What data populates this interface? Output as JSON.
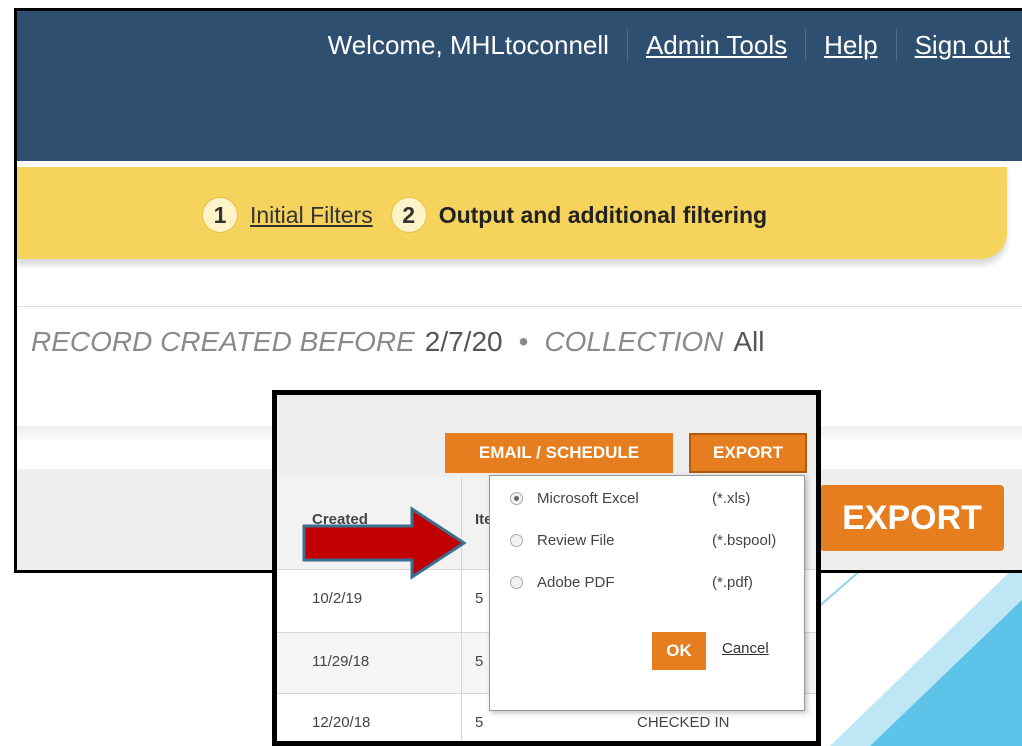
{
  "header": {
    "welcome": "Welcome, MHLtoconnell",
    "links": [
      "Admin Tools",
      "Help",
      "Sign out"
    ]
  },
  "steps": [
    {
      "num": "1",
      "label": "Initial Filters"
    },
    {
      "num": "2",
      "label": "Output and additional filtering"
    }
  ],
  "summary": {
    "created_label": "RECORD CREATED BEFORE",
    "created_value": "2/7/20",
    "sep": "•",
    "collection_label": "COLLECTION",
    "collection_value": "All"
  },
  "toolbar": {
    "export_big": "EXPORT",
    "email_schedule": "EMAIL / SCHEDULE",
    "export_small": "EXPORT"
  },
  "table": {
    "headers": [
      "Created",
      "Ite"
    ],
    "rows": [
      {
        "created": "10/2/19",
        "item": "5",
        "status": ""
      },
      {
        "created": "11/29/18",
        "item": "5",
        "status": ""
      },
      {
        "created": "12/20/18",
        "item": "5",
        "status": "CHECKED IN"
      }
    ]
  },
  "export_menu": {
    "options": [
      {
        "label": "Microsoft Excel",
        "ext": "(*.xls)",
        "selected": true
      },
      {
        "label": "Review File",
        "ext": "(*.bspool)",
        "selected": false
      },
      {
        "label": "Adobe PDF",
        "ext": "(*.pdf)",
        "selected": false
      }
    ],
    "ok": "OK",
    "cancel": "Cancel"
  },
  "colors": {
    "topbar": "#2f4f70",
    "steps_band": "#f6d35c",
    "accent_orange": "#e67d1e",
    "arrow_red": "#c00000"
  }
}
